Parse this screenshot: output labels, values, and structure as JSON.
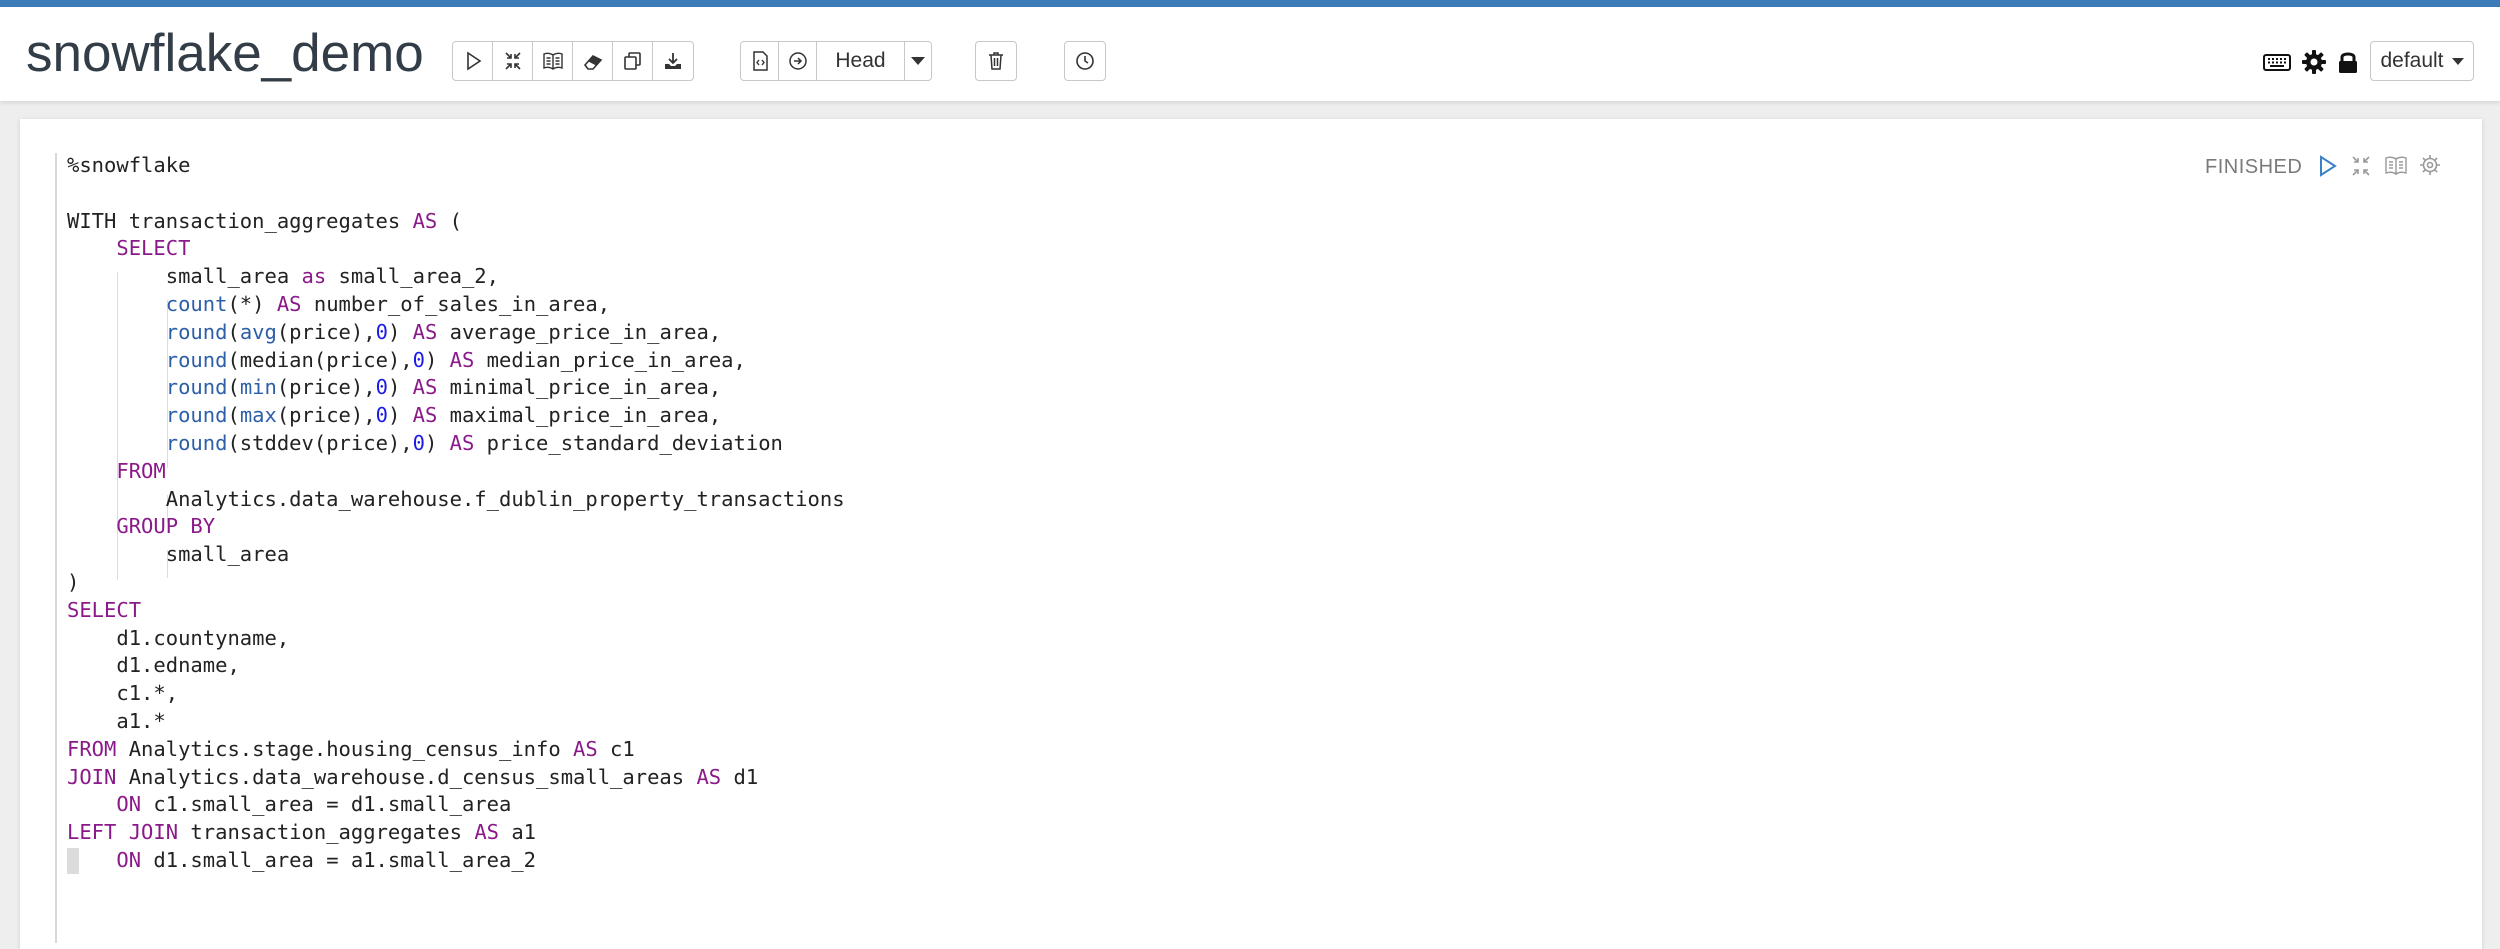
{
  "notebook": {
    "title": "snowflake_demo",
    "head_label": "Head",
    "interpreter_dropdown": "default"
  },
  "toolbar_icons": [
    "run-all-icon",
    "hide-code-icon",
    "show-output-icon",
    "clear-output-icon",
    "clone-icon",
    "export-icon",
    "version-control-icon",
    "commit-icon",
    "trash-icon",
    "schedule-icon"
  ],
  "header_right_icons": [
    "keyboard-icon",
    "settings-icon",
    "lock-icon"
  ],
  "paragraph": {
    "status": "FINISHED",
    "controls": [
      "run-icon",
      "hide-editor-icon",
      "book-icon",
      "paragraph-settings-icon"
    ],
    "code_lines": [
      [
        {
          "t": "%snowflake"
        }
      ],
      [],
      [
        {
          "t": "WITH transaction_aggregates "
        },
        {
          "t": "AS",
          "c": "k"
        },
        {
          "t": " ("
        }
      ],
      [
        {
          "t": "    "
        },
        {
          "t": "SELECT",
          "c": "k"
        }
      ],
      [
        {
          "t": "        small_area "
        },
        {
          "t": "as",
          "c": "k"
        },
        {
          "t": " small_area_2,"
        }
      ],
      [
        {
          "t": "        "
        },
        {
          "t": "count",
          "c": "f"
        },
        {
          "t": "(*) "
        },
        {
          "t": "AS",
          "c": "k"
        },
        {
          "t": " number_of_sales_in_area,"
        }
      ],
      [
        {
          "t": "        "
        },
        {
          "t": "round",
          "c": "f"
        },
        {
          "t": "("
        },
        {
          "t": "avg",
          "c": "f"
        },
        {
          "t": "(price),"
        },
        {
          "t": "0",
          "c": "n"
        },
        {
          "t": ") "
        },
        {
          "t": "AS",
          "c": "k"
        },
        {
          "t": " average_price_in_area,"
        }
      ],
      [
        {
          "t": "        "
        },
        {
          "t": "round",
          "c": "f"
        },
        {
          "t": "(median(price),"
        },
        {
          "t": "0",
          "c": "n"
        },
        {
          "t": ") "
        },
        {
          "t": "AS",
          "c": "k"
        },
        {
          "t": " median_price_in_area,"
        }
      ],
      [
        {
          "t": "        "
        },
        {
          "t": "round",
          "c": "f"
        },
        {
          "t": "("
        },
        {
          "t": "min",
          "c": "f"
        },
        {
          "t": "(price),"
        },
        {
          "t": "0",
          "c": "n"
        },
        {
          "t": ") "
        },
        {
          "t": "AS",
          "c": "k"
        },
        {
          "t": " minimal_price_in_area,"
        }
      ],
      [
        {
          "t": "        "
        },
        {
          "t": "round",
          "c": "f"
        },
        {
          "t": "("
        },
        {
          "t": "max",
          "c": "f"
        },
        {
          "t": "(price),"
        },
        {
          "t": "0",
          "c": "n"
        },
        {
          "t": ") "
        },
        {
          "t": "AS",
          "c": "k"
        },
        {
          "t": " maximal_price_in_area,"
        }
      ],
      [
        {
          "t": "        "
        },
        {
          "t": "round",
          "c": "f"
        },
        {
          "t": "(stddev(price),"
        },
        {
          "t": "0",
          "c": "n"
        },
        {
          "t": ") "
        },
        {
          "t": "AS",
          "c": "k"
        },
        {
          "t": " price_standard_deviation"
        }
      ],
      [
        {
          "t": "    "
        },
        {
          "t": "FROM",
          "c": "k"
        }
      ],
      [
        {
          "t": "        Analytics.data_warehouse.f_dublin_property_transactions"
        }
      ],
      [
        {
          "t": "    "
        },
        {
          "t": "GROUP BY",
          "c": "k"
        }
      ],
      [
        {
          "t": "        small_area"
        }
      ],
      [
        {
          "t": ")"
        }
      ],
      [
        {
          "t": "SELECT",
          "c": "k"
        }
      ],
      [
        {
          "t": "    d1.countyname,"
        }
      ],
      [
        {
          "t": "    d1.edname,"
        }
      ],
      [
        {
          "t": "    c1.*,"
        }
      ],
      [
        {
          "t": "    a1.*"
        }
      ],
      [
        {
          "t": "FROM",
          "c": "k"
        },
        {
          "t": " Analytics.stage.housing_census_info "
        },
        {
          "t": "AS",
          "c": "k"
        },
        {
          "t": " c1"
        }
      ],
      [
        {
          "t": "JOIN",
          "c": "k"
        },
        {
          "t": " Analytics.data_warehouse.d_census_small_areas "
        },
        {
          "t": "AS",
          "c": "k"
        },
        {
          "t": " d1"
        }
      ],
      [
        {
          "t": "    "
        },
        {
          "t": "ON",
          "c": "k"
        },
        {
          "t": " c1.small_area = d1.small_area"
        }
      ],
      [
        {
          "t": "LEFT JOIN",
          "c": "k"
        },
        {
          "t": " transaction_aggregates "
        },
        {
          "t": "AS",
          "c": "k"
        },
        {
          "t": " a1"
        }
      ],
      [
        {
          "t": "    "
        },
        {
          "t": "ON",
          "c": "k"
        },
        {
          "t": " d1.small_area = a1.small_area_2"
        }
      ]
    ]
  }
}
